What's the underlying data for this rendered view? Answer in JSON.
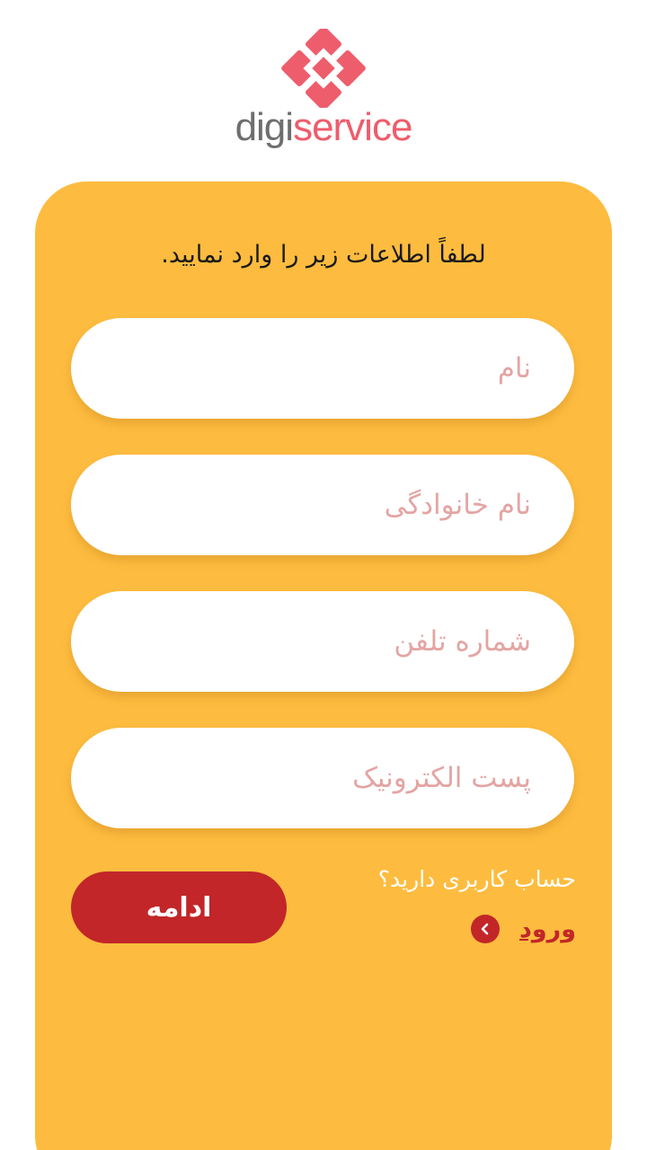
{
  "brand": {
    "name_part1": "digi",
    "name_part2": "service",
    "colors": {
      "primary_red": "#ee5d6c",
      "grey": "#6e6e6e"
    }
  },
  "form": {
    "instruction": "لطفاً اطلاعات زیر را وارد نمایید.",
    "fields": [
      {
        "placeholder": "نام",
        "value": ""
      },
      {
        "placeholder": "نام خانوادگی",
        "value": ""
      },
      {
        "placeholder": "شماره تلفن",
        "value": ""
      },
      {
        "placeholder": "پست الکترونیک",
        "value": ""
      }
    ],
    "continue_label": "ادامه",
    "have_account_text": "حساب کاربری دارید؟",
    "login_label": "ورود",
    "login_icon": "chevron-left-icon"
  },
  "colors": {
    "card_background": "#fdbc3f",
    "button_red": "#c22628",
    "placeholder": "#e3a5a3"
  }
}
